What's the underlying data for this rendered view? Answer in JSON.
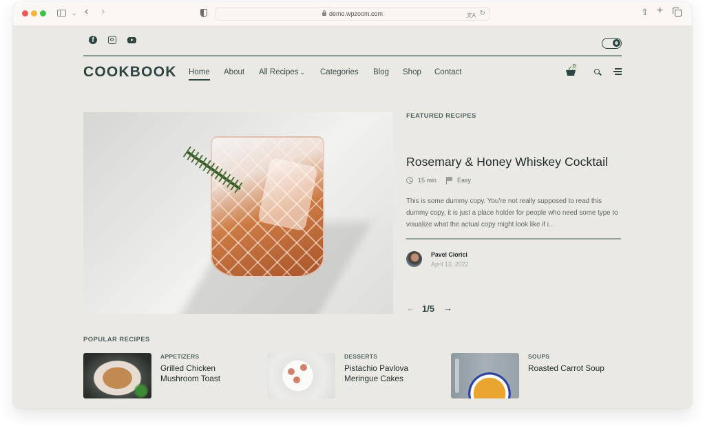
{
  "browser": {
    "url": "demo.wpzoom.com",
    "icons": [
      "close-dot",
      "minimize-dot",
      "zoom-dot",
      "sidebar-icon",
      "chevron-down-icon",
      "back-icon",
      "forward-icon",
      "shield-icon",
      "lock-icon",
      "translate-icon",
      "reload-icon",
      "share-icon",
      "new-tab-icon",
      "tabs-overview-icon"
    ]
  },
  "site": {
    "logo": "COOKBOOK",
    "social": [
      "facebook-icon",
      "instagram-icon",
      "youtube-icon"
    ],
    "nav": [
      {
        "label": "Home",
        "active": true
      },
      {
        "label": "About"
      },
      {
        "label": "All Recipes",
        "dropdown": true
      },
      {
        "label": "Categories"
      },
      {
        "label": "Blog"
      },
      {
        "label": "Shop"
      },
      {
        "label": "Contact"
      }
    ],
    "cart_count": "0",
    "chevron": "⌄"
  },
  "featured": {
    "section_label": "FEATURED RECIPES",
    "title": "Rosemary & Honey Whiskey Cocktail",
    "time": "15 min",
    "difficulty": "Easy",
    "excerpt": "This is some dummy copy. You’re not really supposed to read this dummy copy, it is just a place holder for people who need some type to visualize what the actual copy might look like if i...",
    "author": "Pavel Ciorici",
    "date": "April 13, 2022",
    "slider": {
      "current": 1,
      "total": 5,
      "label": "1/5",
      "prev": "←",
      "next": "→"
    }
  },
  "popular": {
    "section_label": "POPULAR RECIPES",
    "items": [
      {
        "category": "APPETIZERS",
        "title": "Grilled Chicken Mushroom Toast"
      },
      {
        "category": "DESSERTS",
        "title": "Pistachio Pavlova Meringue Cakes"
      },
      {
        "category": "SOUPS",
        "title": "Roasted Carrot Soup"
      }
    ]
  }
}
